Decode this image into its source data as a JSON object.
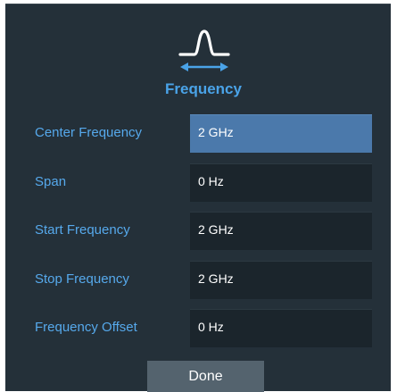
{
  "dialog": {
    "title": "Frequency",
    "icon": "frequency-span-icon",
    "accent_color": "#4aa3e8",
    "selected_field_color": "#4b79ab"
  },
  "fields": [
    {
      "label": "Center Frequency",
      "value": "2 GHz",
      "selected": true
    },
    {
      "label": "Span",
      "value": "0 Hz",
      "selected": false
    },
    {
      "label": "Start Frequency",
      "value": "2 GHz",
      "selected": false
    },
    {
      "label": "Stop Frequency",
      "value": "2 GHz",
      "selected": false
    },
    {
      "label": "Frequency Offset",
      "value": "0 Hz",
      "selected": false
    }
  ],
  "buttons": {
    "done_label": "Done"
  }
}
